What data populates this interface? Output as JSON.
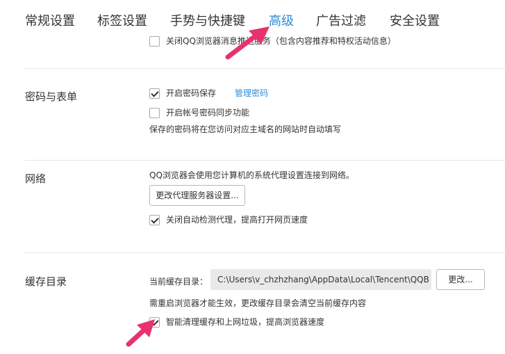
{
  "tabs": [
    {
      "label": "常规设置"
    },
    {
      "label": "标签设置"
    },
    {
      "label": "手势与快捷键"
    },
    {
      "label": "高级"
    },
    {
      "label": "广告过滤"
    },
    {
      "label": "安全设置"
    }
  ],
  "active_tab": "高级",
  "colors": {
    "accent": "#2b8ddb",
    "arrow": "#e8326e"
  },
  "top_partial": {
    "label": "关闭QQ浏览器消息推送服务（包含内容推荐和特权活动信息）"
  },
  "password": {
    "title": "密码与表单",
    "save_password": {
      "label": "开启密码保存",
      "checked": true
    },
    "manage_link": "管理密码",
    "sync_password": {
      "label": "开启帐号密码同步功能",
      "checked": false
    },
    "note": "保存的密码将在您访问对应主域名的网站时自动填写"
  },
  "network": {
    "title": "网络",
    "desc": "QQ浏览器会使用您计算机的系统代理设置连接到网络。",
    "proxy_button": "更改代理服务器设置...",
    "disable_auto_detect": {
      "label": "关闭自动检测代理，提高打开网页速度",
      "checked": true
    }
  },
  "cache": {
    "title": "缓存目录",
    "current_label": "当前缓存目录：",
    "path": "C:\\Users\\v_chzhzhang\\AppData\\Local\\Tencent\\QQB",
    "change_button": "更改...",
    "note": "需重启浏览器才能生效，更改缓存目录会清空当前缓存内容",
    "smart_clean": {
      "label": "智能清理缓存和上网垃圾，提高浏览器速度",
      "checked": true
    }
  }
}
